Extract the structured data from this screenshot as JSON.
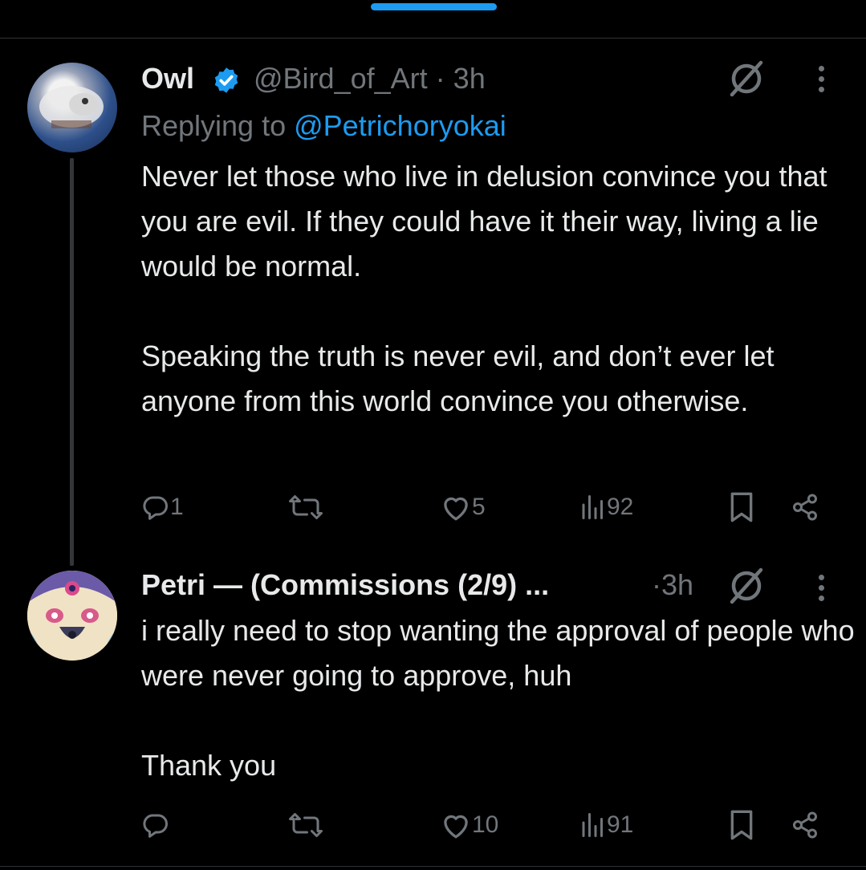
{
  "theme": {
    "accent": "#1d9bf0",
    "muted": "#71767b",
    "text": "#e7e9ea",
    "background": "#000000"
  },
  "tweets": [
    {
      "author_name": "Owl",
      "verified": true,
      "handle": "@Bird_of_Art",
      "separator": "·",
      "time": "3h",
      "replying_to_prefix": "Replying to ",
      "replying_to_handle": "@Petrichoryokai",
      "text": "Never let those who live in delusion convince you that you are evil. If they could have it their way, living a lie would be normal.\n\nSpeaking the truth is never evil, and don’t ever let anyone from this world convince you otherwise.",
      "replies": "1",
      "likes": "5",
      "views": "92",
      "icons": [
        "grok-icon",
        "more-icon",
        "reply-icon",
        "retweet-icon",
        "like-icon",
        "views-icon",
        "bookmark-icon",
        "share-icon"
      ]
    },
    {
      "author_name": "Petri — (Commissions (2/9) ...",
      "separator": "·",
      "time": "3h",
      "text": "i really need to stop wanting the approval of people who were never going to approve, huh\n\nThank you",
      "likes": "10",
      "views": "91",
      "icons": [
        "grok-icon",
        "more-icon",
        "reply-icon",
        "retweet-icon",
        "like-icon",
        "views-icon",
        "bookmark-icon",
        "share-icon"
      ]
    }
  ]
}
